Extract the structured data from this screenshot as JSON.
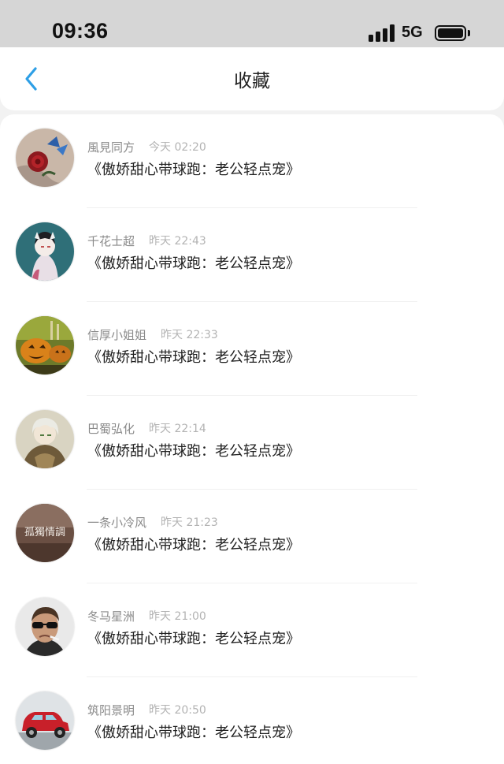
{
  "status_bar": {
    "time": "09:36",
    "network": "5G",
    "battery_level": 1.0
  },
  "header": {
    "back_icon": "chevron-left-icon",
    "title": "收藏"
  },
  "colors": {
    "accent": "#2e9fe6",
    "status_bar_bg": "#d6d6d6",
    "page_bg": "#f2f2f2"
  },
  "favorites": [
    {
      "user": "風見同方",
      "time": "今天 02:20",
      "title": "《傲娇甜心带球跑：老公轻点宠》",
      "avatar": "rose-butterfly"
    },
    {
      "user": "千花士超",
      "time": "昨天 22:43",
      "title": "《傲娇甜心带球跑：老公轻点宠》",
      "avatar": "kitsune-girl"
    },
    {
      "user": "信厚小姐姐",
      "time": "昨天 22:33",
      "title": "《傲娇甜心带球跑：老公轻点宠》",
      "avatar": "pumpkins"
    },
    {
      "user": "巴蜀弘化",
      "time": "昨天 22:14",
      "title": "《傲娇甜心带球跑：老公轻点宠》",
      "avatar": "anime-boy"
    },
    {
      "user": "一条小冷风",
      "time": "昨天 21:23",
      "title": "《傲娇甜心带球跑：老公轻点宠》",
      "avatar": "calligraphy-text",
      "avatar_text": "孤獨情調"
    },
    {
      "user": "冬马星洲",
      "time": "昨天 21:00",
      "title": "《傲娇甜心带球跑：老公轻点宠》",
      "avatar": "man-sunglasses"
    },
    {
      "user": "筑阳景明",
      "time": "昨天 20:50",
      "title": "《傲娇甜心带球跑：老公轻点宠》",
      "avatar": "red-car"
    }
  ]
}
